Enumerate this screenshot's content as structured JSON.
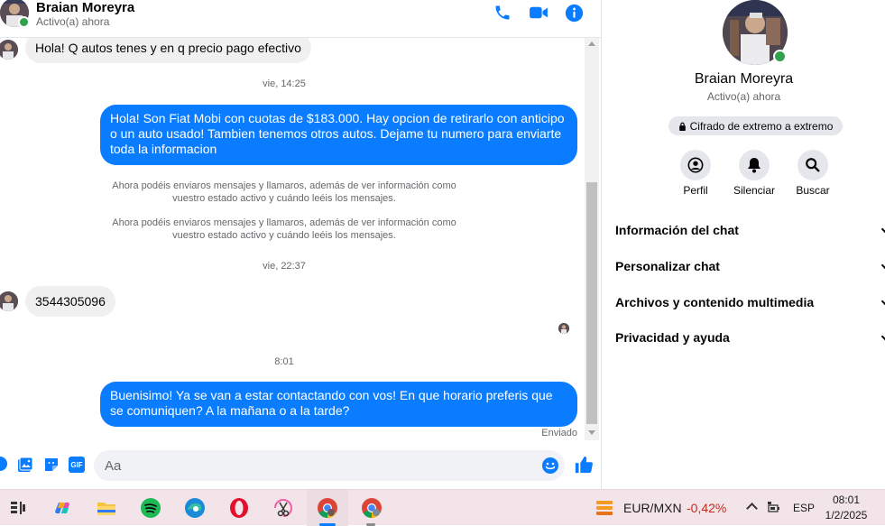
{
  "header": {
    "contact_name": "Braian Moreyra",
    "contact_status": "Activo(a) ahora",
    "icons": [
      "phone-icon",
      "video-icon",
      "info-icon"
    ]
  },
  "messages": {
    "m1": "Hola! Q autos tenes y en q precio pago efectivo",
    "ts1": "vie, 14:25",
    "m2": "Hola! Son Fiat Mobi con cuotas de $183.000. Hay opcion de retirarlo con anticipo o un auto usado! Tambien tenemos otros autos. Dejame tu numero para enviarte toda la informacion",
    "sys1": "Ahora podéis enviaros mensajes y llamaros, además de ver información como vuestro estado activo y cuándo leéis los mensajes.",
    "sys2": "Ahora podéis enviaros mensajes y llamaros, además de ver información como vuestro estado activo y cuándo leéis los mensajes.",
    "ts2": "vie, 22:37",
    "m3": "3544305096",
    "ts3": "8:01",
    "m4": "Buenisimo! Ya se van a estar contactando con vos! En que horario preferis que se comuniquen? A la mañana o a la tarde?",
    "sent_status": "Enviado"
  },
  "composer": {
    "placeholder": "Aa",
    "gif_label": "GIF"
  },
  "panel": {
    "name": "Braian Moreyra",
    "status": "Activo(a) ahora",
    "encryption": "Cifrado de extremo a extremo",
    "actions": [
      {
        "label": "Perfil",
        "icon": "profile-icon"
      },
      {
        "label": "Silenciar",
        "icon": "bell-icon"
      },
      {
        "label": "Buscar",
        "icon": "search-icon"
      }
    ],
    "menu": [
      "Información del chat",
      "Personalizar chat",
      "Archivos y contenido multimedia",
      "Privacidad y ayuda"
    ]
  },
  "taskbar": {
    "currency_pair": "EUR/MXN",
    "currency_change": "-0,42%",
    "language": "ESP",
    "time": "08:01",
    "date": "1/2/2025",
    "colors": {
      "negative": "#c42b1c",
      "messenger_blue": "#0a7cff"
    }
  }
}
